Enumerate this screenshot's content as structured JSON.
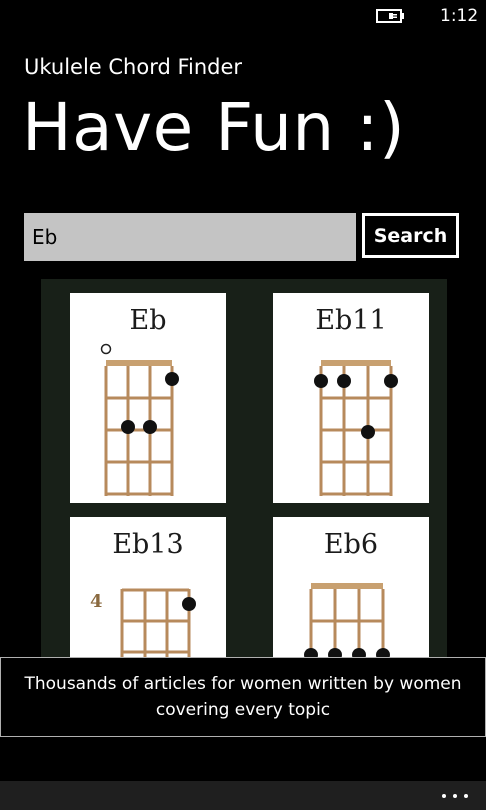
{
  "status": {
    "time": "1:12",
    "battery_icon": "battery-charging-icon"
  },
  "app": {
    "title": "Ukulele Chord Finder",
    "page_title": "Have Fun :)"
  },
  "search": {
    "value": "Eb",
    "button_label": "Search"
  },
  "chords": [
    {
      "name": "Eb"
    },
    {
      "name": "Eb11"
    },
    {
      "name": "Eb13",
      "fret_number": "4"
    },
    {
      "name": "Eb6"
    }
  ],
  "ad": {
    "text": "Thousands of articles for women written by women covering every topic"
  },
  "app_bar": {
    "more_icon": "more-ellipsis-icon"
  },
  "colors": {
    "background": "#000000",
    "input_background": "#c4c4c4",
    "fretboard": "#b78a5c",
    "grid_background": "#182018"
  }
}
